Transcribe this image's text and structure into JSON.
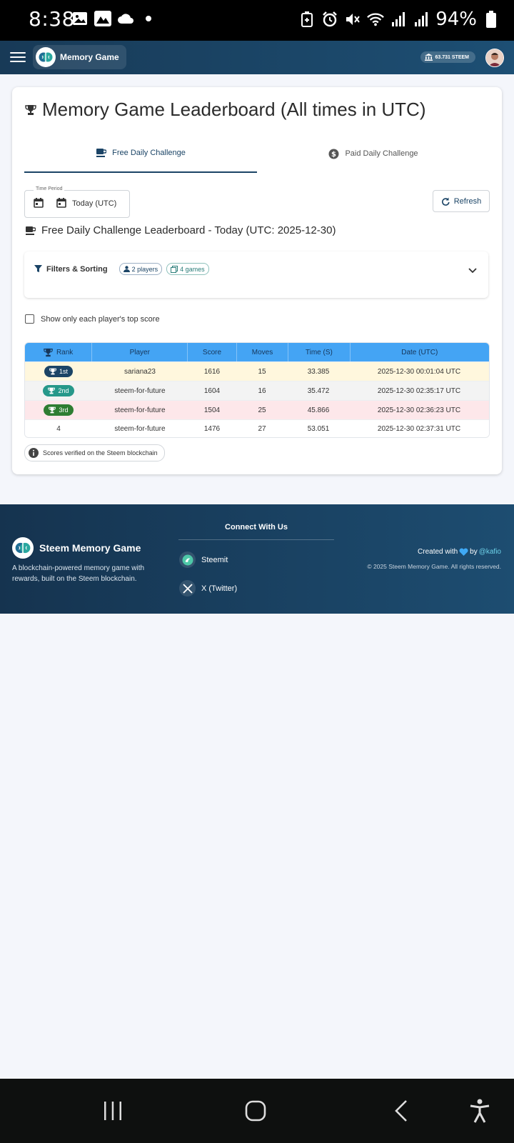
{
  "status_bar": {
    "time": "8:38",
    "battery": "94%",
    "icons_left": [
      "image-icon",
      "gallery-icon",
      "cloud-icon",
      "dot-icon"
    ],
    "icons_right": [
      "battery-saver-icon",
      "alarm-icon",
      "mute-icon",
      "wifi-icon",
      "signal-icon",
      "signal-icon",
      "battery-icon"
    ]
  },
  "app_bar": {
    "title": "Memory Game",
    "balance": "63.731 STEEM"
  },
  "card": {
    "title": "Memory Game Leaderboard (All times in UTC)",
    "tabs": [
      {
        "label": "Free Daily Challenge",
        "active": true
      },
      {
        "label": "Paid Daily Challenge",
        "active": false
      }
    ],
    "time_period": {
      "label": "Time Period",
      "value": "Today (UTC)"
    },
    "refresh_label": "Refresh",
    "sub_title": "Free Daily Challenge Leaderboard - Today (UTC: 2025-12-30)",
    "filters": {
      "title": "Filters & Sorting",
      "players_pill": "2 players",
      "games_pill": "4 games"
    },
    "top_score_label": "Show only each player's top score",
    "table": {
      "headers": [
        "Rank",
        "Player",
        "Score",
        "Moves",
        "Time (S)",
        "Date (UTC)"
      ],
      "rows": [
        {
          "rank": "1st",
          "player": "sariana23",
          "score": "1616",
          "moves": "15",
          "time": "33.385",
          "date": "2025-12-30 00:01:04 UTC"
        },
        {
          "rank": "2nd",
          "player": "steem-for-future",
          "score": "1604",
          "moves": "16",
          "time": "35.472",
          "date": "2025-12-30 02:35:17 UTC"
        },
        {
          "rank": "3rd",
          "player": "steem-for-future",
          "score": "1504",
          "moves": "25",
          "time": "45.866",
          "date": "2025-12-30 02:36:23 UTC"
        },
        {
          "rank": "4",
          "player": "steem-for-future",
          "score": "1476",
          "moves": "27",
          "time": "53.051",
          "date": "2025-12-30 02:37:31 UTC"
        }
      ]
    },
    "verified_label": "Scores verified on the Steem blockchain"
  },
  "footer": {
    "brand": "Steem Memory Game",
    "description": "A blockchain-powered memory game with rewards, built on the Steem blockchain.",
    "connect_title": "Connect With Us",
    "links": [
      "Steemit",
      "X (Twitter)"
    ],
    "created_prefix": "Created with",
    "created_by": "by",
    "handle": "@kafio",
    "copyright": "© 2025 Steem Memory Game. All rights reserved."
  },
  "colors": {
    "header": "#1d4f74",
    "table_header": "#44a4f4",
    "gold_row": "#fff7dd",
    "bronze_row": "#fde7ea",
    "badge_1": "#1b4466",
    "badge_2": "#26988a",
    "badge_3": "#2e7d32"
  }
}
